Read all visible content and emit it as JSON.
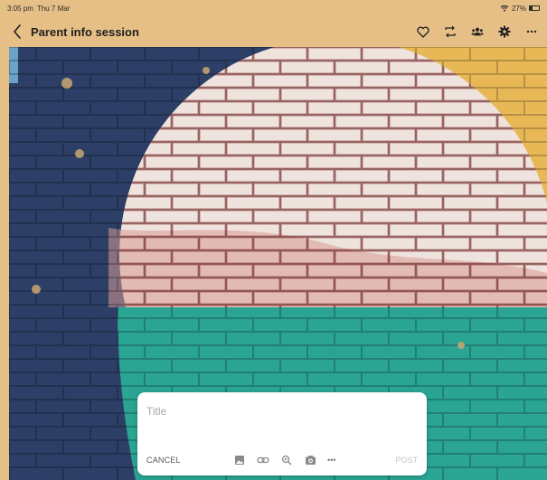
{
  "status_bar": {
    "time": "3:05 pm",
    "date": "Thu 7 Mar",
    "battery_text": "27%",
    "battery_level": 0.27,
    "icons": [
      "wifi-icon",
      "battery-icon"
    ]
  },
  "nav": {
    "title": "Parent info session",
    "icons": [
      "back-chevron-icon",
      "heart-icon",
      "repost-icon",
      "people-icon",
      "gear-icon",
      "more-horizontal-icon"
    ]
  },
  "composer": {
    "title_placeholder": "Title",
    "title_value": "",
    "cancel_label": "CANCEL",
    "post_label": "POST",
    "more_label": "•••",
    "tool_icons": [
      "image-icon",
      "link-icon",
      "zoom-icon",
      "camera-icon",
      "more-icon"
    ]
  },
  "colors": {
    "header_bg": "#e6bf86",
    "wall_blue": "#2d3f66",
    "wall_teal": "#2aa493",
    "wall_yellow": "#e9b856",
    "wall_white": "#efe3dd",
    "wall_red": "#c35a5a"
  }
}
